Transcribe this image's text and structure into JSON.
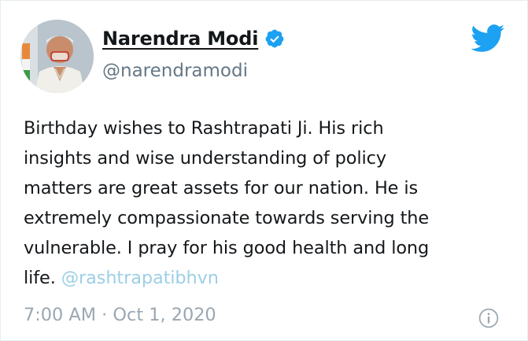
{
  "author": {
    "display_name": "Narendra Modi",
    "handle": "@narendramodi",
    "verified": true
  },
  "tweet": {
    "lines": [
      "Birthday wishes to Rashtrapati Ji. His rich",
      "insights and wise understanding of policy",
      "matters are great assets for our nation. He is",
      "extremely compassionate towards serving the",
      "vulnerable. I pray for his good health and long",
      "life. "
    ],
    "mention": "@rashtrapatibhvn"
  },
  "meta": {
    "timestamp": "7:00 AM · Oct 1, 2020"
  },
  "icons": {
    "logo": "twitter-bird-icon",
    "verified": "verified-badge-icon",
    "info": "info-icon"
  },
  "colors": {
    "brand": "#1da1f2",
    "text": "#14171a",
    "secondary": "#657786",
    "mention": "#9ccfe6",
    "timestamp": "#9aa7b2"
  }
}
